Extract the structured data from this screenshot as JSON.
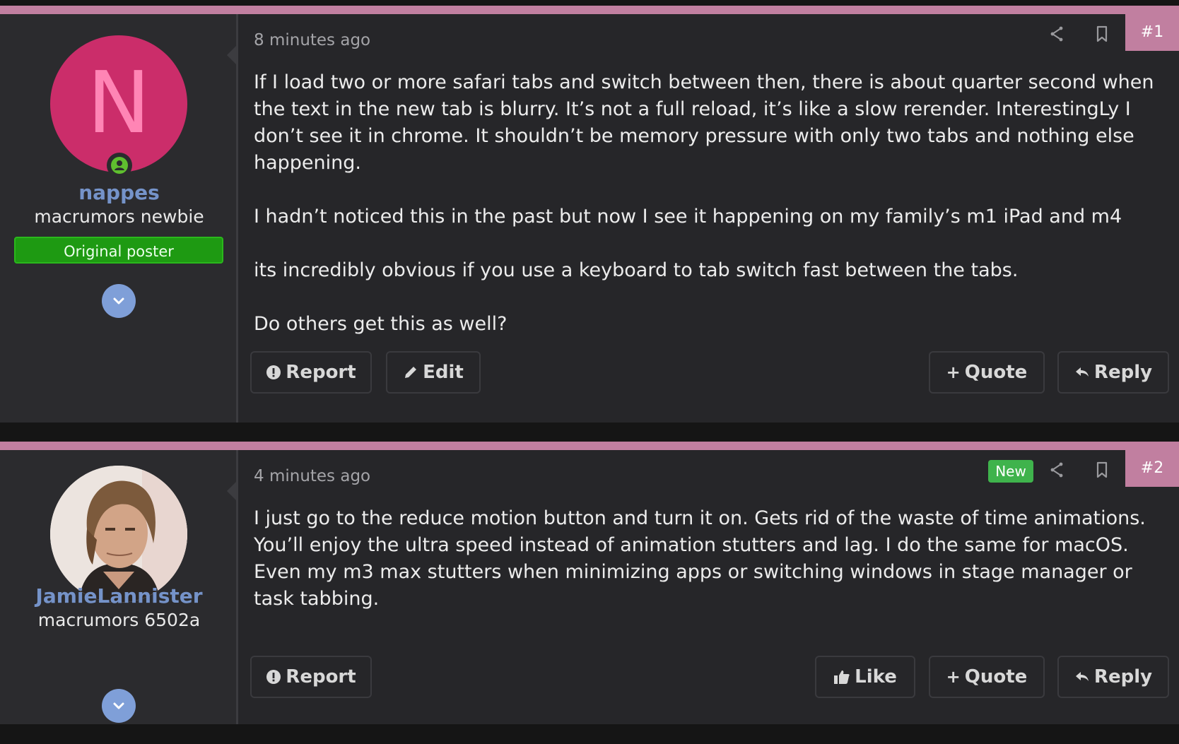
{
  "posts": [
    {
      "author": {
        "avatar_letter": "N",
        "avatar_color": "#cb2d6a",
        "name": "nappes",
        "title": "macrumors newbie",
        "badge": "Original poster",
        "online": true
      },
      "timestamp": "8 minutes ago",
      "number": "#1",
      "is_new": false,
      "paragraphs": [
        "If I load two or more safari tabs and switch between then, there is about quarter second when the text in the new tab is blurry. It’s not a full reload, it’s like a slow rerender. InterestingLy I don’t see it in chrome. It shouldn’t be memory pressure with only two tabs and nothing else happening.",
        "I hadn’t noticed this in the past but now I see it happening on my family’s m1 iPad and m4",
        "its incredibly obvious if you use a keyboard to tab switch fast between the tabs.",
        "Do others get this as well?"
      ],
      "actions": {
        "report": "Report",
        "edit": "Edit",
        "quote": "Quote",
        "reply": "Reply"
      }
    },
    {
      "author": {
        "avatar_type": "photo",
        "name": "JamieLannister",
        "title": "macrumors 6502a"
      },
      "timestamp": "4 minutes ago",
      "number": "#2",
      "is_new": true,
      "new_label": "New",
      "paragraphs": [
        "I just go to the reduce motion button and turn it on. Gets rid of the waste of time animations. You’ll enjoy the ultra speed instead of animation stutters and lag. I do the same for macOS. Even my m3 max stutters when minimizing apps or switching windows in stage manager or task tabbing."
      ],
      "actions": {
        "report": "Report",
        "like": "Like",
        "quote": "Quote",
        "reply": "Reply"
      }
    }
  ],
  "icons": {
    "share": "share-icon",
    "bookmark": "bookmark-icon",
    "report": "exclamation-circle-icon",
    "edit": "pencil-icon",
    "quote": "plus-icon",
    "reply": "reply-arrow-icon",
    "like": "thumbs-up-icon",
    "expand": "chevron-down-icon"
  },
  "colors": {
    "accent": "#c17fa0",
    "username": "#7593c9",
    "op_badge": "#1e9a12",
    "new_badge": "#3fb34c"
  }
}
